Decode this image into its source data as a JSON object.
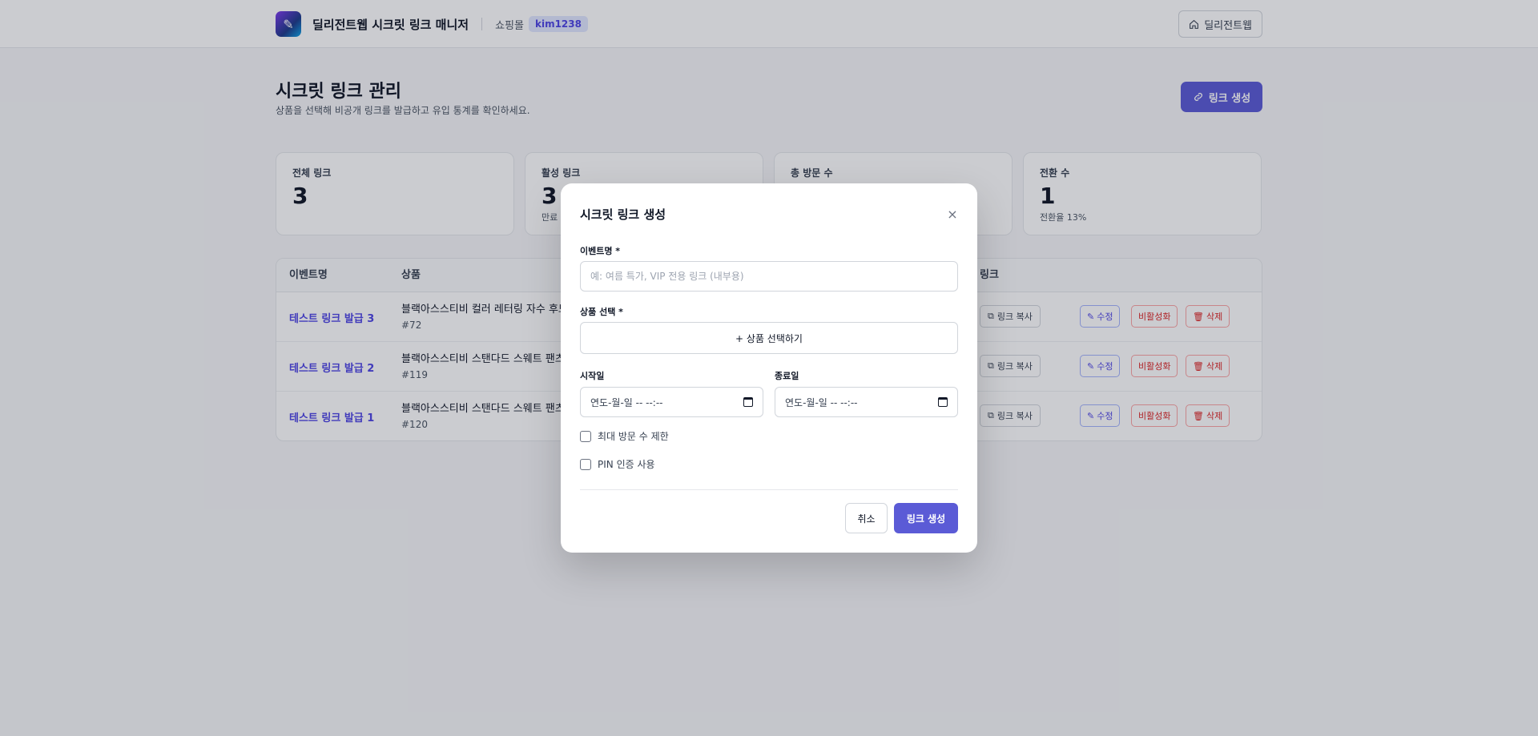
{
  "header": {
    "app_title": "딜리전트웹 시크릿 링크 매니저",
    "mall_label": "쇼핑몰",
    "mall_id": "kim1238",
    "home_button": "딜리전트웹"
  },
  "page": {
    "title": "시크릿 링크 관리",
    "subtitle": "상품을 선택해 비공개 링크를 발급하고 유입 통계를 확인하세요.",
    "create_button": "링크 생성"
  },
  "stats": [
    {
      "label": "전체 링크",
      "value": "3",
      "note": ""
    },
    {
      "label": "활성 링크",
      "value": "3",
      "note": "만료"
    },
    {
      "label": "총 방문 수",
      "value": "",
      "note": ""
    },
    {
      "label": "전환 수",
      "value": "1",
      "note": "전환율 13%"
    }
  ],
  "table": {
    "headers": {
      "event": "이벤트명",
      "product": "상품",
      "link": "링크"
    },
    "rows": [
      {
        "event": "테스트 링크 발급 3",
        "product": "블랙아스스티비 컬러 레터링 자수 후드 티셔츠",
        "pid": "#72",
        "copy": "링크 복사",
        "edit": "수정",
        "deactivate": "비활성화",
        "delete": "삭제"
      },
      {
        "event": "테스트 링크 발급 2",
        "product": "블랙아스스티비 스탠다드 스웨트 팬츠 BLACK",
        "pid": "#119",
        "copy": "링크 복사",
        "edit": "수정",
        "deactivate": "비활성화",
        "delete": "삭제"
      },
      {
        "event": "테스트 링크 발급 1",
        "product": "블랙아스스티비 스탠다드 스웨트 팬츠 PINK",
        "pid": "#120",
        "copy": "링크 복사",
        "edit": "수정",
        "deactivate": "비활성화",
        "delete": "삭제"
      }
    ]
  },
  "modal": {
    "title": "시크릿 링크 생성",
    "close": "×",
    "event_label": "이벤트명 *",
    "event_placeholder": "예: 여름 특가, VIP 전용 링크 (내부용)",
    "product_label": "상품 선택 *",
    "product_button": "+ 상품 선택하기",
    "start_label": "시작일",
    "end_label": "종료일",
    "date_placeholder": "연도-월-일 -- --:--",
    "max_visits_label": "최대 방문 수 제한",
    "pin_label": "PIN 인증 사용",
    "cancel_button": "취소",
    "submit_button": "링크 생성"
  },
  "colors": {
    "accent": "#5b5bd6",
    "danger": "#dc2626"
  }
}
